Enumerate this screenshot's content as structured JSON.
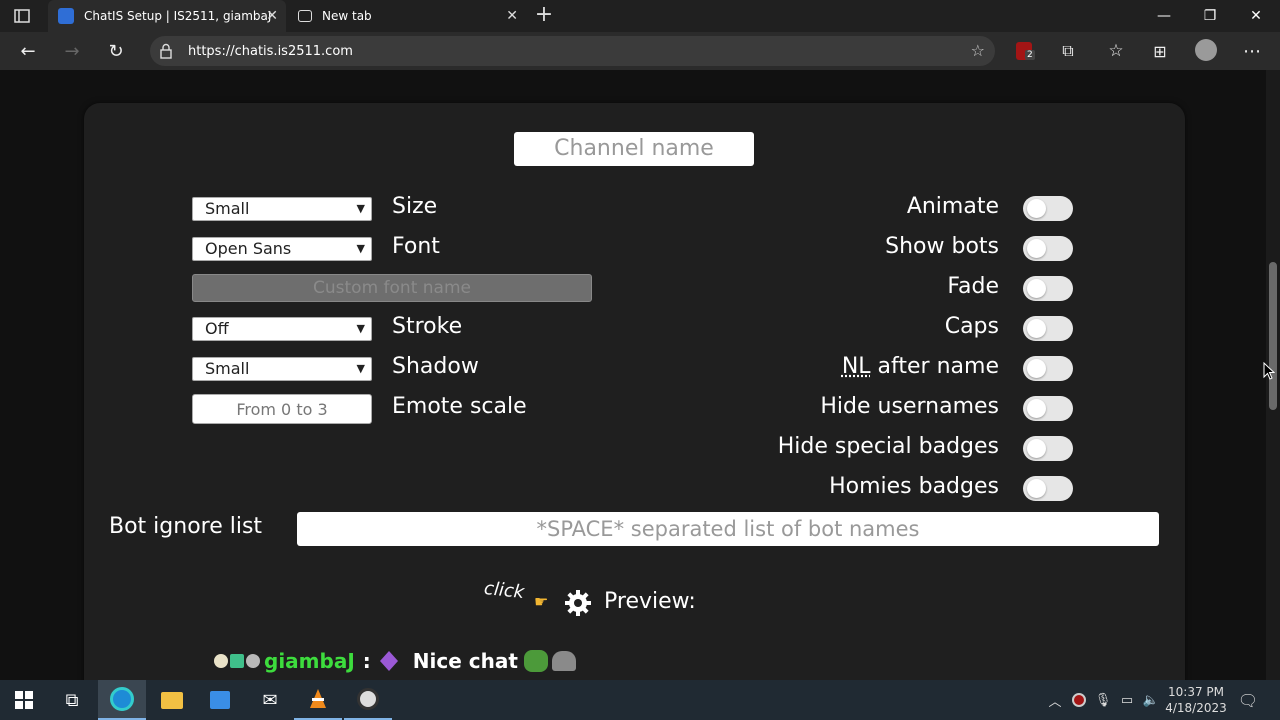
{
  "browser": {
    "tabs": [
      {
        "title": "ChatIS Setup | IS2511, giambaJ",
        "active": true
      },
      {
        "title": "New tab",
        "active": false
      }
    ],
    "url": "https://chatis.is2511.com",
    "extension_badge": "2"
  },
  "form": {
    "channel_placeholder": "Channel name",
    "left": [
      {
        "control": "select",
        "value": "Small",
        "label": "Size"
      },
      {
        "control": "select",
        "value": "Open Sans",
        "label": "Font"
      },
      {
        "control": "button",
        "value": "Custom font name",
        "label": ""
      },
      {
        "control": "select",
        "value": "Off",
        "label": "Stroke"
      },
      {
        "control": "select",
        "value": "Small",
        "label": "Shadow"
      },
      {
        "control": "input",
        "placeholder": "From 0 to 3",
        "label": "Emote scale"
      }
    ],
    "toggles": [
      {
        "label": "Animate",
        "on": false
      },
      {
        "label": "Show bots",
        "on": false
      },
      {
        "label": "Fade",
        "on": false
      },
      {
        "label": "Caps",
        "on": false
      },
      {
        "label": "NL",
        "label_rest": " after name",
        "on": false
      },
      {
        "label": "Hide usernames",
        "on": false
      },
      {
        "label": "Hide special badges",
        "on": false
      },
      {
        "label": "Homies badges",
        "on": false
      }
    ],
    "bot_ignore_label": "Bot ignore list",
    "bot_ignore_placeholder": "*SPACE* separated list of bot names"
  },
  "preview": {
    "click_text": "click",
    "label": "Preview:",
    "username": "giambaJ",
    "separator": ":",
    "message": "Nice chat",
    "username_color": "#3ddc3d"
  },
  "taskbar": {
    "time": "10:37 PM",
    "date": "4/18/2023"
  }
}
